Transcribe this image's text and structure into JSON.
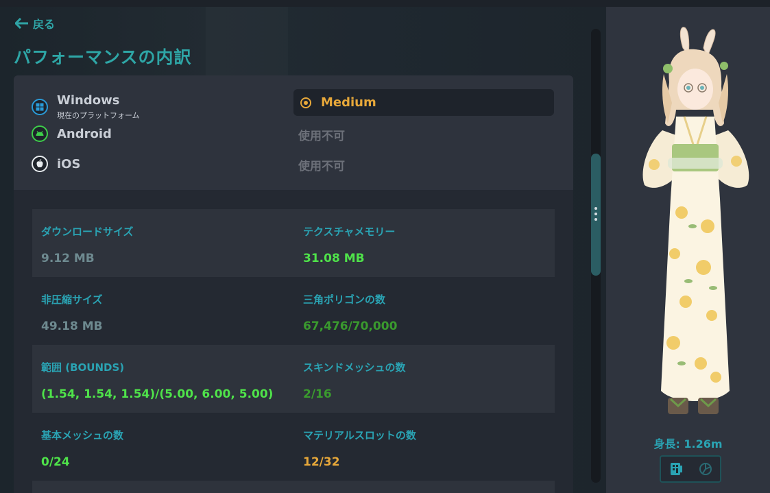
{
  "nav": {
    "back_label": "戻る"
  },
  "page": {
    "title": "パフォーマンスの内訳"
  },
  "platforms": [
    {
      "name": "Windows",
      "sub": "現在のプラットフォーム",
      "icon": "windows-icon",
      "rank": "Medium",
      "selected": true
    },
    {
      "name": "Android",
      "sub": "",
      "icon": "android-icon",
      "rank": "使用不可",
      "selected": false
    },
    {
      "name": "iOS",
      "sub": "",
      "icon": "apple-icon",
      "rank": "使用不可",
      "selected": false
    }
  ],
  "stats": [
    {
      "label": "ダウンロードサイズ",
      "value": "9.12 MB",
      "color": "#6e8a90"
    },
    {
      "label": "テクスチャメモリー",
      "value": "31.08 MB",
      "color": "#4fe34a"
    },
    {
      "label": "非圧縮サイズ",
      "value": "49.18 MB",
      "color": "#6e8a90"
    },
    {
      "label": "三角ポリゴンの数",
      "value": "67,476/70,000",
      "color": "#3a9a2e"
    },
    {
      "label": "範囲 (BOUNDS)",
      "value": "(1.54, 1.54, 1.54)/(5.00, 6.00, 5.00)",
      "color": "#4fe34a"
    },
    {
      "label": "スキンドメッシュの数",
      "value": "2/16",
      "color": "#3a9a2e"
    },
    {
      "label": "基本メッシュの数",
      "value": "0/24",
      "color": "#4fe34a"
    },
    {
      "label": "マテリアルスロットの数",
      "value": "12/32",
      "color": "#e7a83a"
    }
  ],
  "avatar": {
    "height_label": "身長: 1.26m"
  },
  "colors": {
    "accent": "#2aa3b3",
    "medium": "#e7a83a",
    "good": "#4fe34a"
  }
}
